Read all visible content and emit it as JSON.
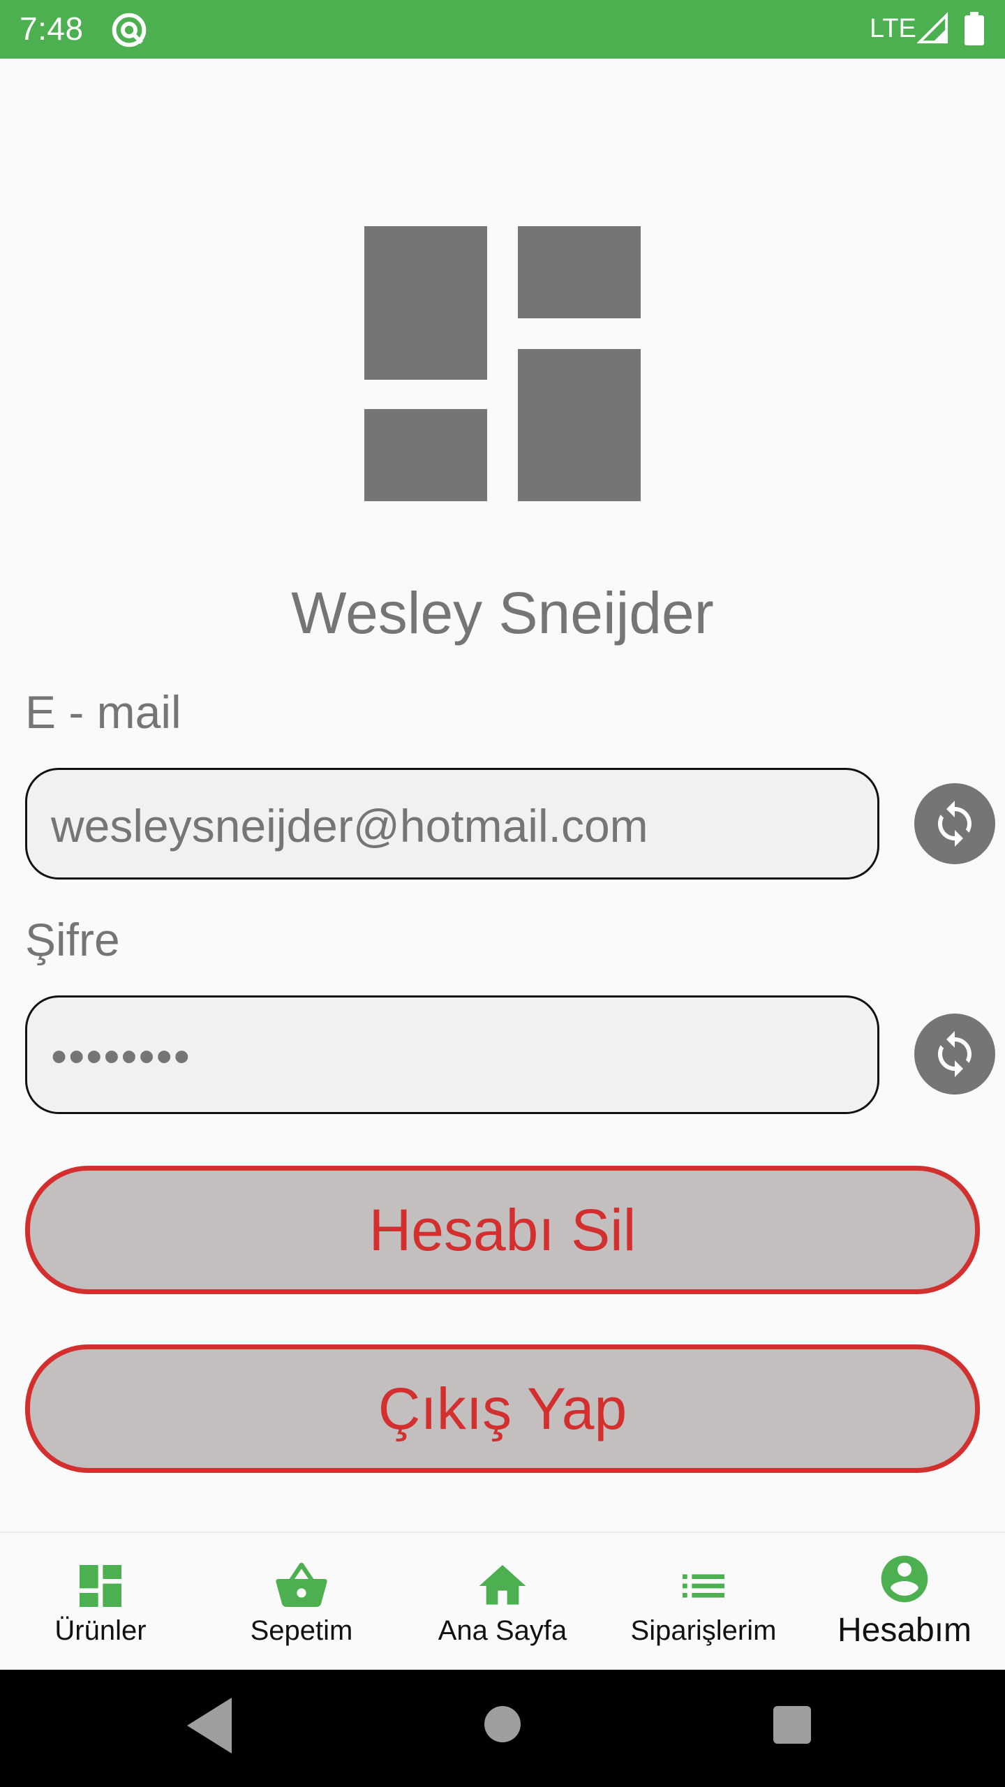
{
  "status_bar": {
    "time": "7:48",
    "network": "LTE",
    "background_color": "#4caf50",
    "icons": [
      "vpn-key-icon",
      "cellular-signal-icon",
      "battery-full-icon"
    ]
  },
  "profile": {
    "logo_icon": "dashboard-logo-icon",
    "name": "Wesley Sneijder"
  },
  "email": {
    "label": "E - mail",
    "value": "wesleysneijder@hotmail.com",
    "refresh_icon": "refresh-icon"
  },
  "password": {
    "label": "Şifre",
    "value": "••••••••",
    "refresh_icon": "refresh-icon"
  },
  "actions": {
    "delete_account": "Hesabı Sil",
    "logout": "Çıkış Yap",
    "accent_color": "#d32f2f"
  },
  "bottom_nav": {
    "items": [
      {
        "label": "Ürünler",
        "icon": "dashboard-icon"
      },
      {
        "label": "Sepetim",
        "icon": "shopping-basket-icon"
      },
      {
        "label": "Ana Sayfa",
        "icon": "home-icon"
      },
      {
        "label": "Siparişlerim",
        "icon": "list-icon"
      },
      {
        "label": "Hesabım",
        "icon": "account-circle-icon"
      }
    ],
    "active_label": "Hesabım",
    "icon_color": "#4caf50"
  },
  "system_nav": {
    "icons": [
      "back-icon",
      "home-circle-icon",
      "recents-icon"
    ]
  }
}
